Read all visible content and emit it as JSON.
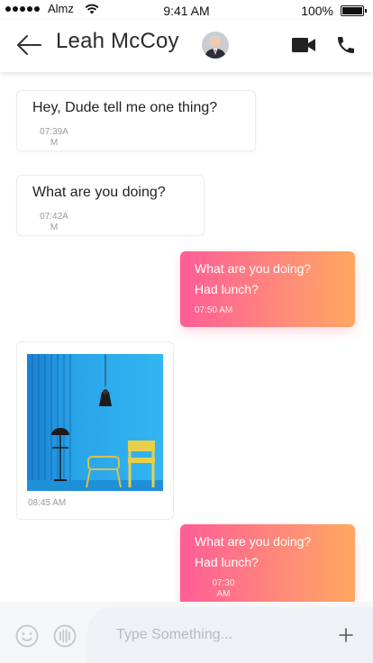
{
  "status_bar": {
    "carrier": "Almz",
    "time": "9:41 AM",
    "battery": "100%"
  },
  "header": {
    "contact_name": "Leah McCoy",
    "icons": {
      "back": "back-arrow-icon",
      "video": "video-camera-icon",
      "call": "phone-icon"
    }
  },
  "messages": [
    {
      "direction": "incoming",
      "text": "Hey, Dude tell me one thing?",
      "time_line1": "07:39A",
      "time_line2": "M"
    },
    {
      "direction": "incoming",
      "text": "What are you doing?",
      "time_line1": "07:42A",
      "time_line2": "M"
    },
    {
      "direction": "outgoing",
      "line1": "What are you doing?",
      "line2": "Had lunch?",
      "time": "07:50 AM"
    },
    {
      "direction": "incoming",
      "type": "image",
      "time": "08:45 AM"
    },
    {
      "direction": "outgoing",
      "line1": "What are you doing?",
      "line2": "Had lunch?",
      "time_line1": "07:30",
      "time_line2": "AM"
    }
  ],
  "composer": {
    "placeholder": "Type Something...",
    "icons": {
      "emoji": "emoji-icon",
      "voice": "voice-waveform-icon",
      "add": "plus-icon"
    }
  },
  "colors": {
    "outgoing_gradient_start": "#ff5d96",
    "outgoing_gradient_end": "#ffa760"
  }
}
